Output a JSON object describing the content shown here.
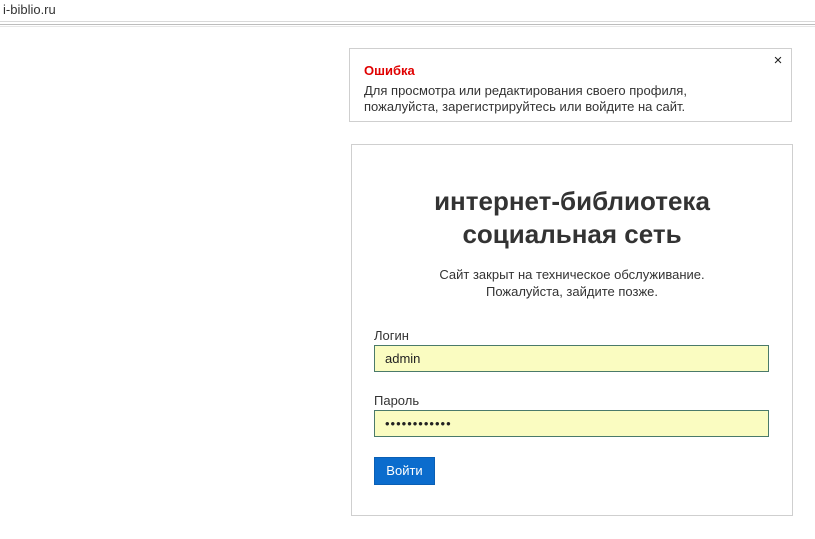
{
  "site": {
    "name": "i-biblio.ru"
  },
  "alert": {
    "title": "Ошибка",
    "message_line1": "Для просмотра или редактирования своего профиля,",
    "message_line2": "пожалуйста, зарегистрируйтесь или войдите на сайт.",
    "close_glyph": "×",
    "title_color": "#e00000"
  },
  "login": {
    "headline_line1": "интернет-библиотека",
    "headline_line2": "социальная сеть",
    "notice_line1": "Сайт закрыт на техническое обслуживание.",
    "notice_line2": "Пожалуйста, зайдите позже.",
    "username_label": "Логин",
    "username_value": "admin",
    "password_label": "Пароль",
    "password_value": "••••••••••••",
    "submit_label": "Войти",
    "input_background": "#fafcc1",
    "button_color": "#0b6ccd"
  }
}
